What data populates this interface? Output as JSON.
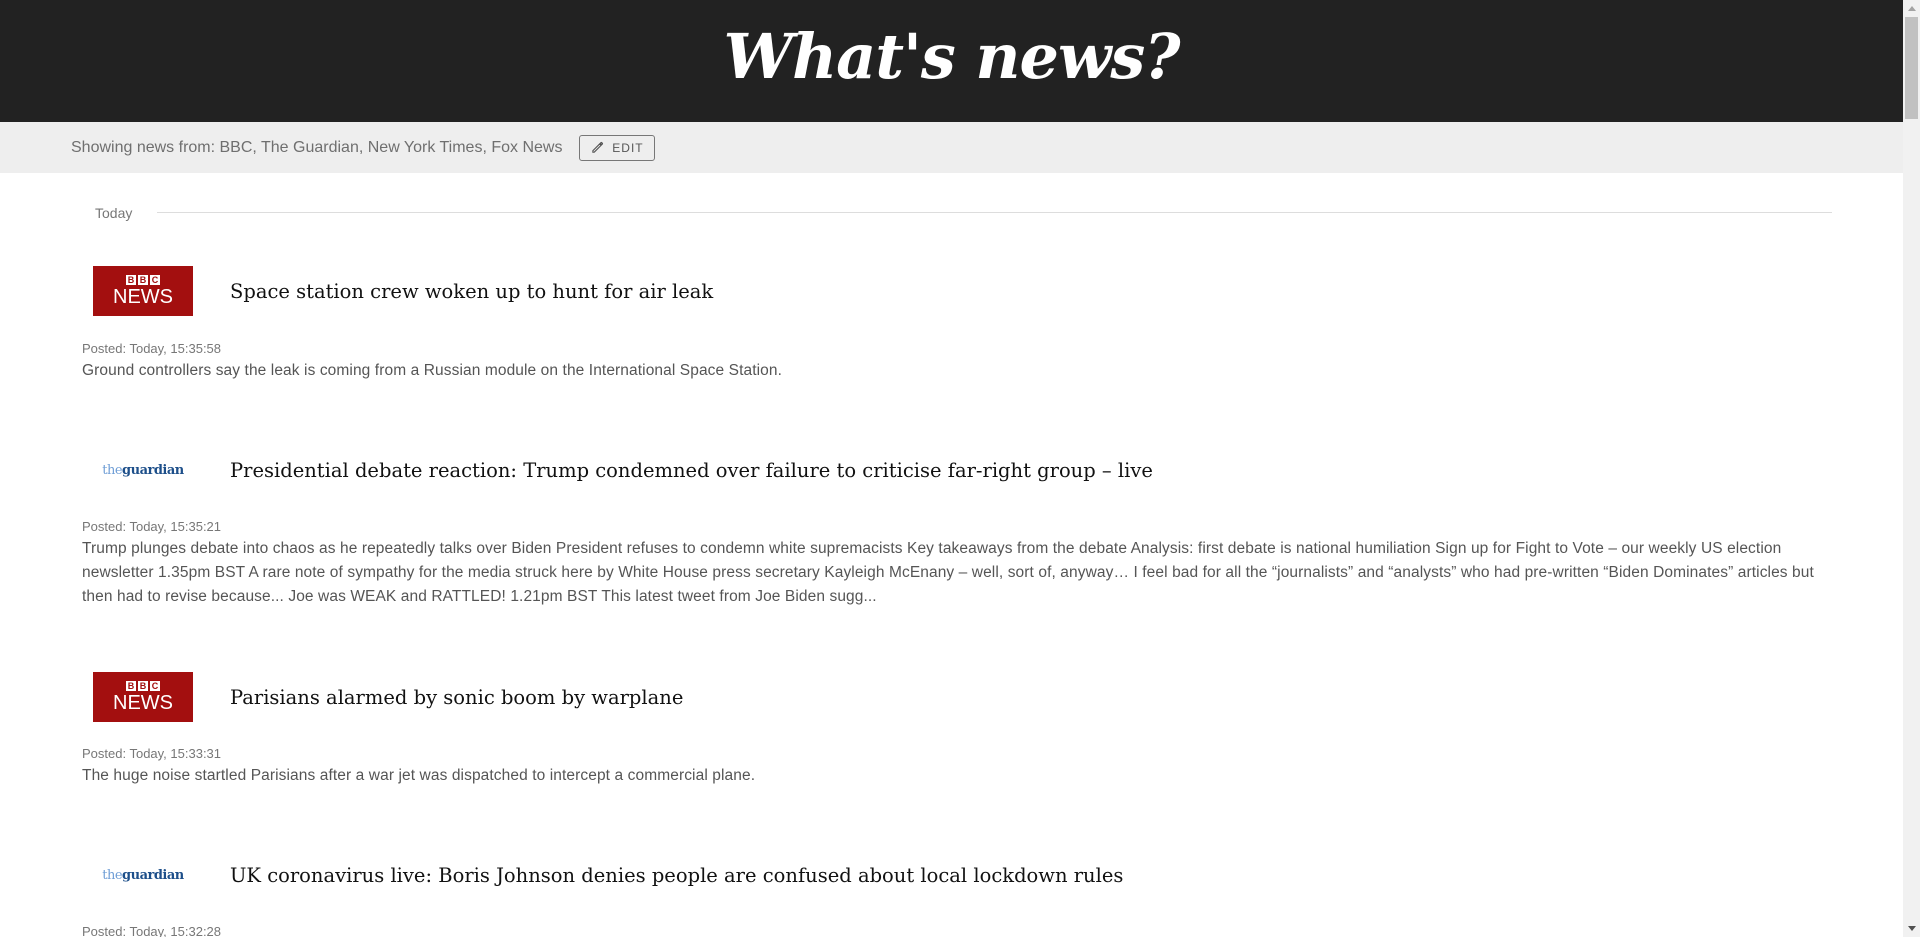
{
  "header": {
    "title": "What's news?"
  },
  "sources_bar": {
    "text": "Showing news from: BBC, The Guardian, New York Times, Fox News",
    "edit_label": "EDIT"
  },
  "feed": {
    "section_label": "Today",
    "articles": [
      {
        "source": "bbc",
        "logo": {
          "top": "BBC",
          "bottom": "NEWS"
        },
        "headline": "Space station crew woken up to hunt for air leak",
        "posted": "Posted: Today, 15:35:58",
        "summary": "Ground controllers say the leak is coming from a Russian module on the International Space Station."
      },
      {
        "source": "guardian",
        "logo": {
          "the": "the",
          "name": "guardian"
        },
        "headline": "Presidential debate reaction: Trump condemned over failure to criticise far-right group – live",
        "posted": "Posted: Today, 15:35:21",
        "summary": "Trump plunges debate into chaos as he repeatedly talks over Biden President refuses to condemn white supremacists Key takeaways from the debate Analysis: first debate is national humiliation Sign up for Fight to Vote – our weekly US election newsletter 1.35pm BST A rare note of sympathy for the media struck here by White House press secretary Kayleigh McEnany – well, sort of, anyway… I feel bad for all the “journalists” and “analysts” who had pre-written “Biden Dominates” articles but then had to revise because... Joe was WEAK and RATTLED! 1.21pm BST This latest tweet from Joe Biden sugg..."
      },
      {
        "source": "bbc",
        "logo": {
          "top": "BBC",
          "bottom": "NEWS"
        },
        "headline": "Parisians alarmed by sonic boom by warplane",
        "posted": "Posted: Today, 15:33:31",
        "summary": "The huge noise startled Parisians after a war jet was dispatched to intercept a commercial plane."
      },
      {
        "source": "guardian",
        "logo": {
          "the": "the",
          "name": "guardian"
        },
        "headline": "UK coronavirus live: Boris Johnson denies people are confused about local lockdown rules",
        "posted": "Posted: Today, 15:32:28",
        "summary": ""
      }
    ]
  },
  "colors": {
    "header_bg": "#222222",
    "bar_bg": "#eeeeee",
    "bbc_red": "#a30f0f",
    "guardian_blue": "#1d4f8a"
  },
  "icons": {
    "edit": "pencil-icon",
    "scroll_up": "arrow-up-icon",
    "scroll_down": "arrow-down-icon"
  }
}
